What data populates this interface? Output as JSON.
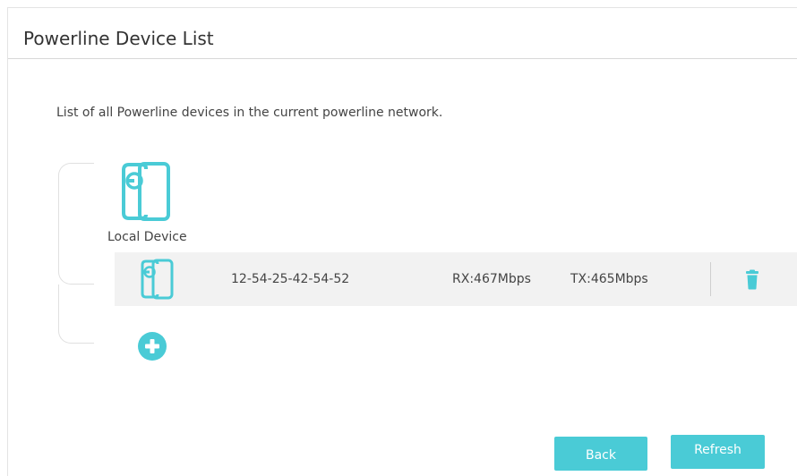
{
  "header": {
    "title": "Powerline Device List"
  },
  "description": "List of all Powerline devices in the current powerline network.",
  "local_device": {
    "label": "Local Device",
    "icon": "powerline-adapter-icon"
  },
  "devices": [
    {
      "mac": "12-54-25-42-54-52",
      "rx": "RX:467Mbps",
      "tx": "TX:465Mbps",
      "icon": "powerline-adapter-icon",
      "action_icon": "trash-icon"
    }
  ],
  "add_icon": "plus-circle-icon",
  "buttons": {
    "back": "Back",
    "refresh": "Refresh"
  },
  "colors": {
    "accent": "#4acbd6",
    "row_background": "#f2f2f2",
    "text": "#444444"
  }
}
